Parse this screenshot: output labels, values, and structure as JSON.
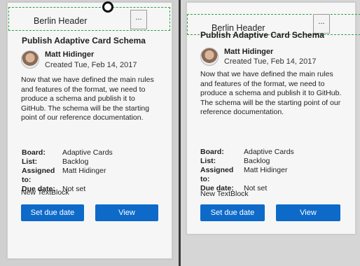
{
  "left": {
    "header_title": "Berlin Header",
    "more_label": "...",
    "card_title": "Publish Adaptive Card Schema",
    "author": "Matt Hidinger",
    "created": "Created Tue, Feb 14, 2017",
    "body": "Now that we have defined the main rules and features of the format, we need to produce a schema and publish it to GitHub. The schema will be the starting point of our reference documentation.",
    "facts": [
      {
        "key": "Board:",
        "value": "Adaptive Cards"
      },
      {
        "key": "List:",
        "value": "Backlog"
      },
      {
        "key": "Assigned to:",
        "value": "Matt Hidinger"
      },
      {
        "key": "Due date:",
        "value": "Not set"
      }
    ],
    "new_textblock": "New TextBlock",
    "btn_due": "Set due date",
    "btn_view": "View"
  },
  "right": {
    "header_title": "Berlin Header",
    "more_label": "...",
    "card_title": "Publish Adaptive Card Schema",
    "author": "Matt Hidinger",
    "created": "Created Tue, Feb 14, 2017",
    "body": "Now that we have defined the main rules and features of the format, we need to produce a schema and publish it to GitHub. The schema will be the starting point of our reference documentation.",
    "facts": [
      {
        "key": "Board:",
        "value": "Adaptive Cards"
      },
      {
        "key": "List:",
        "value": "Backlog"
      },
      {
        "key": "Assigned to:",
        "value": "Matt Hidinger"
      },
      {
        "key": "Due date:",
        "value": "Not set"
      }
    ],
    "new_textblock": "New TextBlock",
    "btn_due": "Set due date",
    "btn_view": "View"
  },
  "colors": {
    "accent": "#0e6ac9",
    "selection_outline": "#2ea043"
  }
}
